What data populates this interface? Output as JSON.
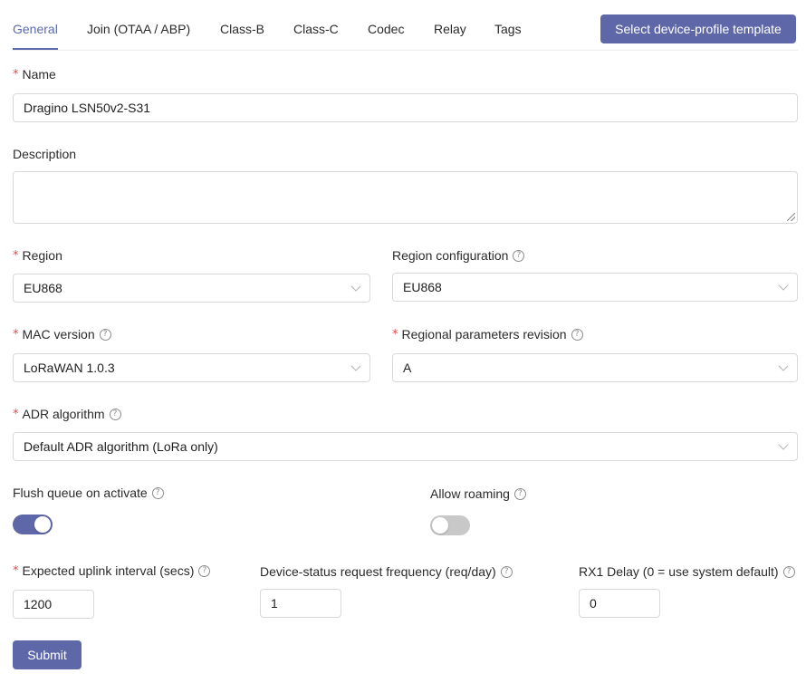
{
  "tabs": [
    {
      "label": "General",
      "active": true
    },
    {
      "label": "Join (OTAA / ABP)"
    },
    {
      "label": "Class-B"
    },
    {
      "label": "Class-C"
    },
    {
      "label": "Codec"
    },
    {
      "label": "Relay"
    },
    {
      "label": "Tags"
    }
  ],
  "template_button": "Select device-profile template",
  "form": {
    "name": {
      "label": "Name",
      "required": true,
      "value": "Dragino LSN50v2-S31"
    },
    "description": {
      "label": "Description",
      "value": ""
    },
    "region": {
      "label": "Region",
      "required": true,
      "value": "EU868"
    },
    "region_config": {
      "label": "Region configuration",
      "value": "EU868"
    },
    "mac_version": {
      "label": "MAC version",
      "required": true,
      "value": "LoRaWAN 1.0.3"
    },
    "regional_revision": {
      "label": "Regional parameters revision",
      "required": true,
      "value": "A"
    },
    "adr": {
      "label": "ADR algorithm",
      "required": true,
      "value": "Default ADR algorithm (LoRa only)"
    },
    "flush_queue": {
      "label": "Flush queue on activate",
      "on": true
    },
    "allow_roaming": {
      "label": "Allow roaming",
      "on": false
    },
    "uplink_interval": {
      "label": "Expected uplink interval (secs)",
      "required": true,
      "value": "1200"
    },
    "status_freq": {
      "label": "Device-status request frequency (req/day)",
      "value": "1"
    },
    "rx1_delay": {
      "label": "RX1 Delay (0 = use system default)",
      "value": "0"
    }
  },
  "submit_label": "Submit",
  "icons": {
    "required_mark": "*",
    "help": "?"
  },
  "colors": {
    "accent": "#5e68a8",
    "required": "#e34a4a",
    "toggle_off": "#c8c8c8"
  }
}
